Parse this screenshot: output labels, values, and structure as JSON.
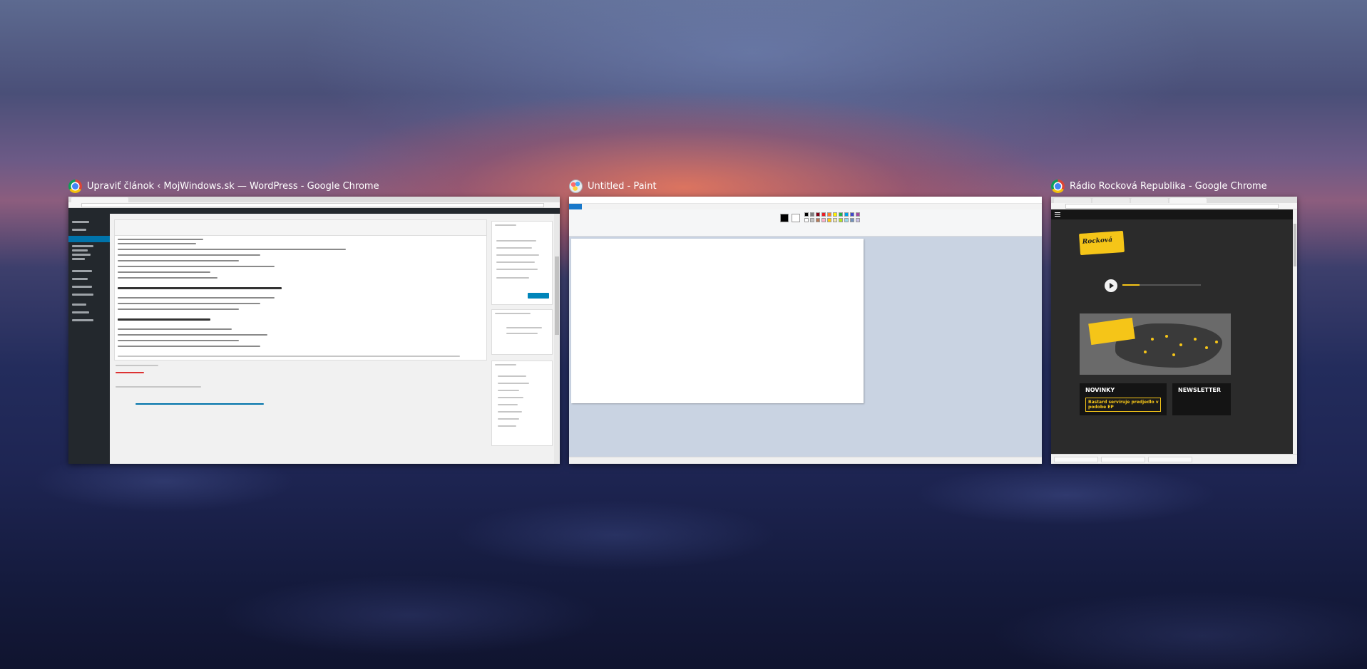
{
  "task_view": {
    "windows": [
      {
        "app": "Google Chrome",
        "icon": "chrome-icon",
        "title": "Upraviť článok ‹ MojWindows.sk — WordPress - Google Chrome"
      },
      {
        "app": "Paint",
        "icon": "paint-icon",
        "title": "Untitled - Paint"
      },
      {
        "app": "Google Chrome",
        "icon": "chrome-icon",
        "title": "Rádio Rocková Republika - Google Chrome",
        "content": {
          "novinky": "NOVINKY",
          "newsletter": "NEWSLETTER",
          "headline": "Bastard servíruje predjedlo v podobe EP"
        }
      }
    ]
  },
  "colors": {
    "wallpaper_top": "#5d6a90",
    "wallpaper_bottom": "#10142f",
    "wp_admin": "#23282d",
    "wp_accent": "#0073aa",
    "rr_accent": "#f5c518",
    "paint_file_tab": "#1979ca"
  }
}
